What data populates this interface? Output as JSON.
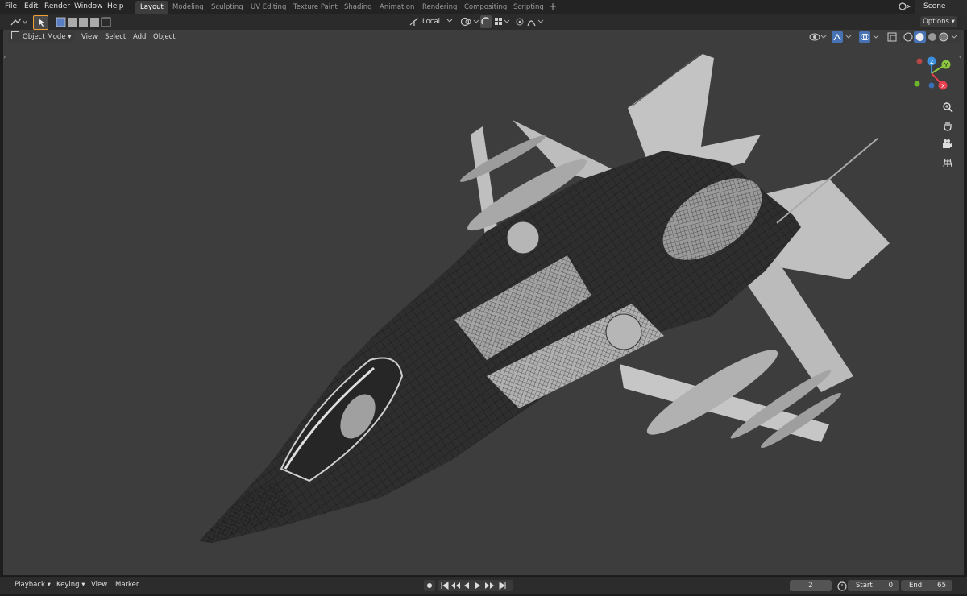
{
  "menu": [
    "File",
    "Edit",
    "Render",
    "Window",
    "Help"
  ],
  "workspaces": [
    "Layout",
    "Modeling",
    "Sculpting",
    "UV Editing",
    "Texture Paint",
    "Shading",
    "Animation",
    "Rendering",
    "Compositing",
    "Scripting"
  ],
  "active_workspace": "Layout",
  "add_workspace": "+",
  "scene": "Scene",
  "tool_header": {
    "transform_orientation": "Local",
    "options": "Options"
  },
  "viewport_header": {
    "mode": "Object Mode",
    "menus": [
      "View",
      "Select",
      "Add",
      "Object"
    ]
  },
  "navigation_gizmo": {
    "axes": [
      "Z",
      "Y",
      "X"
    ],
    "colors": {
      "x": "#e8404f",
      "y": "#8cc63f",
      "z": "#3b8edb"
    }
  },
  "viewport_tools": [
    "zoom-icon",
    "hand-pan-icon",
    "camera-icon",
    "grid-view-icon"
  ],
  "timeline": {
    "menus": [
      "Playback",
      "Keying",
      "View",
      "Marker"
    ],
    "current_frame": "2",
    "start_label": "Start",
    "start": "0",
    "end_label": "End",
    "end": "65"
  },
  "colors": {
    "viewport_bg": "#3d3d3d",
    "active_tab": "#3d3d3d",
    "select_tool": "#f0a030"
  }
}
